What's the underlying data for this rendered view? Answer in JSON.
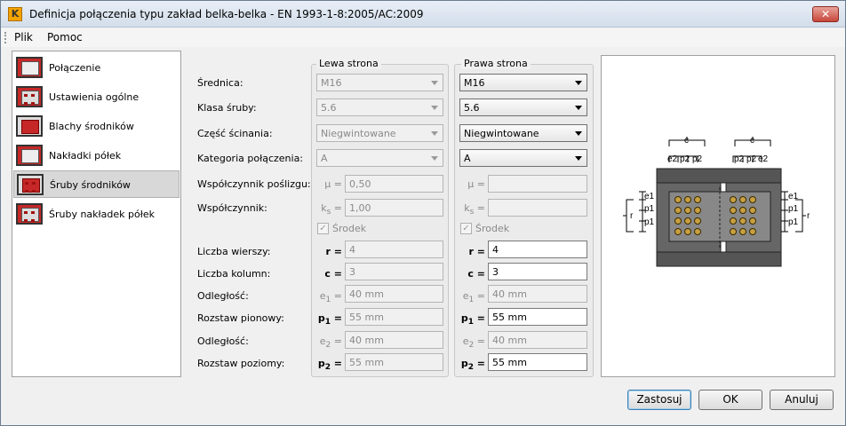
{
  "window": {
    "title": "Definicja połączenia typu zakład belka-belka - EN 1993-1-8:2005/AC:2009",
    "close_glyph": "✕",
    "app_icon_letter": "K"
  },
  "menu": {
    "items": [
      "Plik",
      "Pomoc"
    ]
  },
  "nav": {
    "items": [
      {
        "label": "Połączenie",
        "icon": "splice-icon",
        "selected": false
      },
      {
        "label": "Ustawienia ogólne",
        "icon": "general-settings-icon",
        "selected": false
      },
      {
        "label": "Blachy środników",
        "icon": "web-plates-icon",
        "selected": false
      },
      {
        "label": "Nakładki półek",
        "icon": "flange-plates-icon",
        "selected": false
      },
      {
        "label": "Śruby środników",
        "icon": "web-bolts-icon",
        "selected": true
      },
      {
        "label": "Śruby nakładek półek",
        "icon": "flange-bolts-icon",
        "selected": false
      }
    ]
  },
  "groups": {
    "left": "Lewa strona",
    "right": "Prawa strona"
  },
  "labels": {
    "diameter": "Średnica:",
    "bolt_class": "Klasa śruby:",
    "shear_part": "Część ścinania:",
    "category": "Kategoria połączenia:",
    "slip_coef": "Współczynnik poślizgu:",
    "coef": "Współczynnik:",
    "rows": "Liczba wierszy:",
    "cols": "Liczba kolumn:",
    "dist1": "Odległość:",
    "pitch_v": "Rozstaw pionowy:",
    "dist2": "Odległość:",
    "pitch_h": "Rozstaw poziomy:"
  },
  "symbols": {
    "mu": "μ =",
    "k": "k",
    "k_sub": "s",
    "k_eq": " =",
    "r": "r =",
    "c": "c =",
    "e": "e",
    "p": "p",
    "sub1": "1",
    "sub2": "2",
    "eq": " ="
  },
  "left": {
    "diameter": "M16",
    "bolt_class": "5.6",
    "shear_part": "Niegwintowane",
    "category": "A",
    "mu": "0,50",
    "ks": "1,00",
    "center_label": "Środek",
    "rows": "4",
    "cols": "3",
    "e1": "40 mm",
    "p1": "55 mm",
    "e2": "40 mm",
    "p2": "55 mm"
  },
  "right": {
    "diameter": "M16",
    "bolt_class": "5.6",
    "shear_part": "Niegwintowane",
    "category": "A",
    "mu": "",
    "ks": "",
    "center_label": "Środek",
    "rows": "4",
    "cols": "3",
    "e1": "40 mm",
    "p1": "55 mm",
    "e2": "40 mm",
    "p2": "55 mm"
  },
  "check_glyph": "✓",
  "preview": {
    "c": "c",
    "e2": "e2",
    "p2": "p2",
    "e1": "e1",
    "p1": "p1",
    "r": "r"
  },
  "buttons": {
    "apply": "Zastosuj",
    "ok": "OK",
    "cancel": "Anuluj"
  }
}
